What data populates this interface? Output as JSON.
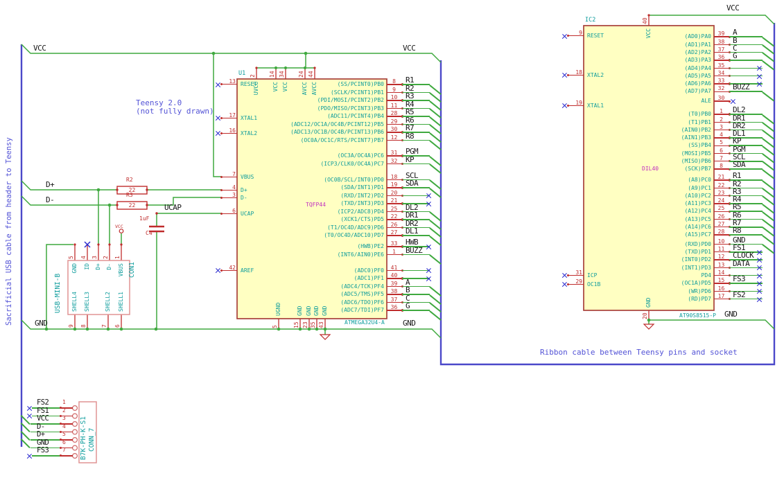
{
  "colors": {
    "wire": "#3fa93f",
    "bus": "#4b48c9",
    "pin": "#bf2c2c",
    "body_outline": "#a8403a",
    "body_fill": "#ffffc2",
    "pin_name": "#0e9c9c",
    "footprint": "#c02ec0",
    "note": "#5353d6",
    "label": "#161616",
    "no_connect": "#2b2bcf"
  },
  "labels": {
    "vcc": "VCC",
    "gnd": "GND",
    "dplus": "D+",
    "dminus": "D-",
    "ucap": "UCAP"
  },
  "notes": {
    "left_vertical": "Sacrificial USB cable from header to Teensy",
    "teensy": "Teensy 2.0\n(not fully drawn)",
    "ribbon": "Ribbon cable between Teensy pins and socket"
  },
  "u1": {
    "ref": "U1",
    "value": "ATMEGA32U4-A",
    "footprint": "TQFP44",
    "left_pins": [
      {
        "num": 13,
        "name": "RESET",
        "conn": "nc"
      },
      {
        "num": 17,
        "name": "XTAL1",
        "conn": "nc"
      },
      {
        "num": 16,
        "name": "XTAL2",
        "conn": "nc"
      },
      {
        "num": 7,
        "name": "VBUS",
        "conn": "wire"
      },
      {
        "num": 4,
        "name": "D+",
        "conn": "wire"
      },
      {
        "num": 3,
        "name": "D-",
        "conn": "wire"
      },
      {
        "num": 6,
        "name": "UCAP",
        "conn": "wire"
      },
      {
        "num": 42,
        "name": "AREF",
        "conn": "nc"
      }
    ],
    "right_pins": [
      {
        "num": 8,
        "name": "(SS/PCINT0)PB0",
        "label": "R1",
        "conn": "bus"
      },
      {
        "num": 9,
        "name": "(SCLK/PCINT1)PB1",
        "label": "R2",
        "conn": "bus"
      },
      {
        "num": 10,
        "name": "(PDI/MOSI/PCINT2)PB2",
        "label": "R3",
        "conn": "bus"
      },
      {
        "num": 11,
        "name": "(PDO/MISO/PCINT3)PB3",
        "label": "R4",
        "conn": "bus"
      },
      {
        "num": 28,
        "name": "(ADC11/PCINT4)PB4",
        "label": "R5",
        "conn": "bus"
      },
      {
        "num": 29,
        "name": "(ADC12/OC1A/OC4B/PCINT12)PB5",
        "label": "R6",
        "conn": "bus"
      },
      {
        "num": 30,
        "name": "(ADC13/OC1B/OC4B/PCINT13)PB6",
        "label": "R7",
        "conn": "bus"
      },
      {
        "num": 12,
        "name": "(OC0A/OC1C/RTS/PCINT7)PB7",
        "label": "R8",
        "conn": "bus"
      },
      {
        "num": 31,
        "name": "(OC3A/OC4A)PC6",
        "label": "PGM",
        "conn": "bus"
      },
      {
        "num": 32,
        "name": "(ICP3/CLK0/OC4A)PC7",
        "label": "KP",
        "conn": "bus"
      },
      {
        "num": 18,
        "name": "(OC0B/SCL/INT0)PD0",
        "label": "SCL",
        "conn": "bus"
      },
      {
        "num": 19,
        "name": "(SDA/INT1)PD1",
        "label": "SDA",
        "conn": "bus"
      },
      {
        "num": 20,
        "name": "(RXD/INT2)PD2",
        "label": "",
        "conn": "nc"
      },
      {
        "num": 21,
        "name": "(TXD/INT3)PD3",
        "label": "",
        "conn": "nc"
      },
      {
        "num": 25,
        "name": "(ICP2/ADC8)PD4",
        "label": "DL2",
        "conn": "bus"
      },
      {
        "num": 22,
        "name": "(XCK1/CTS)PD5",
        "label": "DR1",
        "conn": "bus"
      },
      {
        "num": 26,
        "name": "(T1/OC4D/ADC9)PD6",
        "label": "DR2",
        "conn": "bus"
      },
      {
        "num": 27,
        "name": "(T0/OC4D/ADC10)PD7",
        "label": "DL1",
        "conn": "bus"
      },
      {
        "num": 33,
        "name": "(HWB)PE2",
        "label": "HWB",
        "conn": "nc"
      },
      {
        "num": 1,
        "name": "(INT6/AIN0)PE6",
        "label": "BUZZ",
        "conn": "bus"
      },
      {
        "num": 41,
        "name": "(ADC0)PF0",
        "label": "",
        "conn": "nc"
      },
      {
        "num": 40,
        "name": "(ADC1)PF1",
        "label": "",
        "conn": "nc"
      },
      {
        "num": 39,
        "name": "(ADC4/TCK)PF4",
        "label": "A",
        "conn": "bus"
      },
      {
        "num": 38,
        "name": "(ADC5/TMS)PF5",
        "label": "B",
        "conn": "bus"
      },
      {
        "num": 37,
        "name": "(ADC6/TDO)PF6",
        "label": "C",
        "conn": "bus"
      },
      {
        "num": 36,
        "name": "(ADC7/TDI)PF7",
        "label": "G",
        "conn": "bus"
      }
    ],
    "top_pins": [
      {
        "num": 2,
        "name": "UVCC"
      },
      {
        "num": 14,
        "name": "VCC"
      },
      {
        "num": 34,
        "name": "VCC"
      },
      {
        "num": 24,
        "name": "AVCC"
      },
      {
        "num": 44,
        "name": "AVCC"
      }
    ],
    "bottom_pins": [
      {
        "num": 5,
        "name": "UGND"
      },
      {
        "num": 15,
        "name": "GND"
      },
      {
        "num": 23,
        "name": "GND"
      },
      {
        "num": 35,
        "name": "GND"
      },
      {
        "num": 43,
        "name": "GND"
      }
    ]
  },
  "ic2": {
    "ref": "IC2",
    "value": "AT90S8515-P",
    "footprint": "DIL40",
    "left_pins": [
      {
        "num": 9,
        "name": "RESET",
        "conn": "nc"
      },
      {
        "num": 18,
        "name": "XTAL2",
        "conn": "nc"
      },
      {
        "num": 19,
        "name": "XTAL1",
        "conn": "nc"
      },
      {
        "num": 31,
        "name": "ICP",
        "conn": "nc"
      },
      {
        "num": 29,
        "name": "OC1B",
        "conn": "nc"
      }
    ],
    "top_pins": [
      {
        "num": 40,
        "name": "VCC"
      }
    ],
    "bottom_pins": [
      {
        "num": 20,
        "name": "GND"
      }
    ],
    "right_pins": [
      {
        "num": 39,
        "name": "(AD0)PA0",
        "label": "A",
        "conn": "bus"
      },
      {
        "num": 38,
        "name": "(AD1)PA1",
        "label": "B",
        "conn": "bus"
      },
      {
        "num": 37,
        "name": "(AD2)PA2",
        "label": "C",
        "conn": "bus"
      },
      {
        "num": 36,
        "name": "(AD3)PA3",
        "label": "G",
        "conn": "bus"
      },
      {
        "num": 35,
        "name": "(AD4)PA4",
        "label": "",
        "conn": "nc"
      },
      {
        "num": 34,
        "name": "(AD5)PA5",
        "label": "",
        "conn": "nc"
      },
      {
        "num": 33,
        "name": "(AD6)PA6",
        "label": "",
        "conn": "nc"
      },
      {
        "num": 32,
        "name": "(AD7)PA7",
        "label": "BUZZ",
        "conn": "bus"
      },
      {
        "num": 30,
        "name": "ALE",
        "label": "",
        "conn": "nc0"
      },
      {
        "num": 1,
        "name": "(T0)PB0",
        "label": "DL2",
        "conn": "bus"
      },
      {
        "num": 2,
        "name": "(T1)PB1",
        "label": "DR1",
        "conn": "bus"
      },
      {
        "num": 3,
        "name": "(AIN0)PB2",
        "label": "DR2",
        "conn": "bus"
      },
      {
        "num": 4,
        "name": "(AIN1)PB3",
        "label": "DL1",
        "conn": "bus"
      },
      {
        "num": 5,
        "name": "(SS)PB4",
        "label": "KP",
        "conn": "bus"
      },
      {
        "num": 6,
        "name": "(MOSI)PB5",
        "label": "PGM",
        "conn": "bus"
      },
      {
        "num": 7,
        "name": "(MISO)PB6",
        "label": "SCL",
        "conn": "bus"
      },
      {
        "num": 8,
        "name": "(SCK)PB7",
        "label": "SDA",
        "conn": "bus"
      },
      {
        "num": 21,
        "name": "(A8)PC0",
        "label": "R1",
        "conn": "bus"
      },
      {
        "num": 22,
        "name": "(A9)PC1",
        "label": "R2",
        "conn": "bus"
      },
      {
        "num": 23,
        "name": "(A10)PC2",
        "label": "R3",
        "conn": "bus"
      },
      {
        "num": 24,
        "name": "(A11)PC3",
        "label": "R4",
        "conn": "bus"
      },
      {
        "num": 25,
        "name": "(A12)PC4",
        "label": "R5",
        "conn": "bus"
      },
      {
        "num": 26,
        "name": "(A13)PC5",
        "label": "R6",
        "conn": "bus"
      },
      {
        "num": 27,
        "name": "(A14)PC6",
        "label": "R7",
        "conn": "bus"
      },
      {
        "num": 28,
        "name": "(A15)PC7",
        "label": "R8",
        "conn": "bus"
      },
      {
        "num": 10,
        "name": "(RXD)PD0",
        "label": "GND",
        "conn": "bus"
      },
      {
        "num": 11,
        "name": "(TXD)PD1",
        "label": "FS1",
        "conn": "nc"
      },
      {
        "num": 12,
        "name": "(INT0)PD2",
        "label": "CLOCK",
        "conn": "nc"
      },
      {
        "num": 13,
        "name": "(INT1)PD3",
        "label": "DATA",
        "conn": "nc"
      },
      {
        "num": 14,
        "name": "PD4",
        "label": "",
        "conn": "nc"
      },
      {
        "num": 15,
        "name": "(OC1A)PD5",
        "label": "FS3",
        "conn": "nc"
      },
      {
        "num": 16,
        "name": "(WR)PD6",
        "label": "",
        "conn": "nc"
      },
      {
        "num": 17,
        "name": "(RD)PD7",
        "label": "FS2",
        "conn": "nc"
      }
    ]
  },
  "con1": {
    "ref": "CON1",
    "value": "USB-MINI-B",
    "top_pins": [
      {
        "num": 5,
        "name": "GND"
      },
      {
        "num": 4,
        "name": "ID"
      },
      {
        "num": 3,
        "name": "D+"
      },
      {
        "num": 2,
        "name": "D-"
      },
      {
        "num": 1,
        "name": "VBUS"
      }
    ],
    "shell_pins": [
      {
        "num": 9,
        "name": "SHELL4"
      },
      {
        "num": 8,
        "name": "SHELL3"
      },
      {
        "num": 7,
        "name": "SHELL2"
      },
      {
        "num": 6,
        "name": "SHELL1"
      }
    ]
  },
  "conn7": {
    "ref": "CONN_7",
    "value": "B7K-PH-K-S1",
    "pins": [
      {
        "num": 1,
        "label": "FS2",
        "conn": "nc"
      },
      {
        "num": 2,
        "label": "FS1",
        "conn": "nc"
      },
      {
        "num": 3,
        "label": "VCC",
        "conn": "bus"
      },
      {
        "num": 4,
        "label": "D-",
        "conn": "bus"
      },
      {
        "num": 5,
        "label": "D+",
        "conn": "bus"
      },
      {
        "num": 6,
        "label": "GND",
        "conn": "bus"
      },
      {
        "num": 7,
        "label": "FS3",
        "conn": "bus_nc"
      }
    ]
  },
  "r2": {
    "ref": "R2",
    "value": "22"
  },
  "r3": {
    "ref": "R3",
    "value": "22"
  },
  "c4": {
    "ref": "C4",
    "value": "1uF"
  },
  "vcc_symbol": "VCC"
}
